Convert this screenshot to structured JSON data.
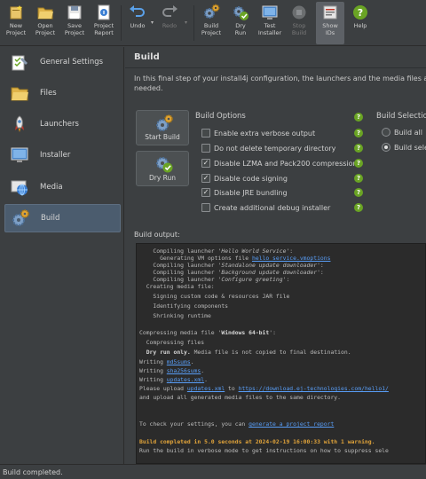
{
  "toolbar": {
    "new_project": "New\nProject",
    "open_project": "Open\nProject",
    "save_project": "Save\nProject",
    "project_report": "Project\nReport",
    "undo": "Undo",
    "redo": "Redo",
    "build_project": "Build\nProject",
    "dry_run": "Dry\nRun",
    "test_installer": "Test\nInstaller",
    "stop_build": "Stop\nBuild",
    "show_ids": "Show\nIDs",
    "help": "Help"
  },
  "sidebar": {
    "items": [
      {
        "label": "General Settings",
        "icon": "wrench-icon"
      },
      {
        "label": "Files",
        "icon": "folder-icon"
      },
      {
        "label": "Launchers",
        "icon": "rocket-icon"
      },
      {
        "label": "Installer",
        "icon": "monitor-icon"
      },
      {
        "label": "Media",
        "icon": "globe-icon"
      },
      {
        "label": "Build",
        "icon": "gears-icon"
      }
    ]
  },
  "main": {
    "title": "Build",
    "description_1": "In this final step of your install4j configuration, the launchers and the media files are bu",
    "description_2": "needed.",
    "start_build": "Start Build",
    "dry_run": "Dry Run",
    "build_options_title": "Build Options",
    "options": [
      {
        "label": "Enable extra verbose output",
        "checked": false
      },
      {
        "label": "Do not delete temporary directory",
        "checked": false
      },
      {
        "label": "Disable LZMA and Pack200 compression",
        "checked": true
      },
      {
        "label": "Disable code signing",
        "checked": true
      },
      {
        "label": "Disable JRE bundling",
        "checked": true
      },
      {
        "label": "Create additional debug installer",
        "checked": false
      }
    ],
    "build_selection_title": "Build Selection",
    "build_all": "Build all",
    "build_selected": "Build sele",
    "build_output_label": "Build output:",
    "help_glyph": "?"
  },
  "output": {
    "l1_pre": "    Compiling launcher '",
    "l1_it": "Hello World Service",
    "l1_post": "':",
    "l2_pre": "      Generating VM options file ",
    "l2_lk": "hello_service.vmoptions",
    "l3_pre": "    Compiling launcher '",
    "l3_it": "Standalone update downloader",
    "l3_post": "':",
    "l4_pre": "    Compiling launcher '",
    "l4_it": "Background update downloader",
    "l4_post": "':",
    "l5_pre": "    Compiling launcher '",
    "l5_it": "Configure greeting",
    "l5_post": "':",
    "l6": "  Creating media file:",
    "l7": "    Signing custom code & resources JAR file",
    "l8": "    Identifying components",
    "l9": "    Shrinking runtime",
    "l10_pre": "Compressing media file '",
    "l10_b": "Windows 64-bit",
    "l10_post": "':",
    "l11": "  Compressing files",
    "l12_b": "  Dry run only.",
    "l12_post": " Media file is not copied to final destination.",
    "l13_pre": "Writing ",
    "l13_lk": "md5sums",
    "l13_post": ".",
    "l14_pre": "Writing ",
    "l14_lk": "sha256sums",
    "l14_post": ".",
    "l15_pre": "Writing ",
    "l15_lk": "updates.xml",
    "l15_post": ".",
    "l16_pre": "Please upload ",
    "l16_lk1": "updates.xml",
    "l16_mid": " to ",
    "l16_lk2": "https://download.ej-technologies.com/hello1/",
    "l17": "and upload all generated media files to the same directory.",
    "l18_pre": "To check your settings, you can ",
    "l18_lk": "generate a project report",
    "l19": "Build completed in 5.0 seconds at 2024-02-19 16:00:33 with 1 warning.",
    "l20": "Run the build in verbose mode to get instructions on how to suppress sele"
  },
  "status": {
    "text": "Build completed."
  },
  "colors": {
    "accent_green": "#6aa424",
    "link": "#589df6",
    "warning": "#e0a33a",
    "selection": "#4b5c6e"
  }
}
